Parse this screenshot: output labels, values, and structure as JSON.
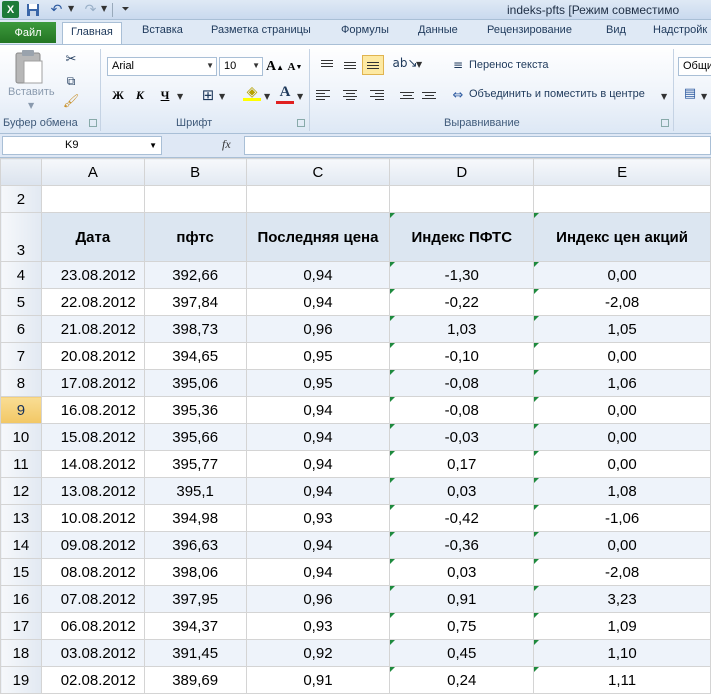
{
  "title_bar": {
    "window_title": "indeks-pfts  [Режим совместимо"
  },
  "ribbon_tabs": {
    "file": "Файл",
    "tabs": [
      "Главная",
      "Вставка",
      "Разметка страницы",
      "Формулы",
      "Данные",
      "Рецензирование",
      "Вид",
      "Надстройк"
    ]
  },
  "ribbon": {
    "paste_label": "Вставить",
    "groups": {
      "clipboard": "Буфер обмена",
      "font": "Шрифт",
      "alignment": "Выравнивание"
    },
    "font_name": "Arial",
    "font_size": "10",
    "bold": "Ж",
    "italic": "К",
    "underline": "Ч",
    "wrap_text": "Перенос текста",
    "merge_center": "Объединить и поместить в центре",
    "number_format": "Общи"
  },
  "formula_bar": {
    "name_box": "K9",
    "fx": "fx",
    "formula": ""
  },
  "sheet": {
    "columns": [
      "A",
      "B",
      "C",
      "D",
      "E"
    ],
    "selected_row": "9",
    "header_row_number": "3",
    "headers": [
      "Дата",
      "пфтс",
      "Последняя цена",
      "Индекс ПФТС",
      "Индекс цен акций"
    ],
    "rows": [
      {
        "n": "4",
        "date": "23.08.2012",
        "pfts": "392,66",
        "last": "0,94",
        "idx": "-1,30",
        "shares": "0,00"
      },
      {
        "n": "5",
        "date": "22.08.2012",
        "pfts": "397,84",
        "last": "0,94",
        "idx": "-0,22",
        "shares": "-2,08"
      },
      {
        "n": "6",
        "date": "21.08.2012",
        "pfts": "398,73",
        "last": "0,96",
        "idx": "1,03",
        "shares": "1,05"
      },
      {
        "n": "7",
        "date": "20.08.2012",
        "pfts": "394,65",
        "last": "0,95",
        "idx": "-0,10",
        "shares": "0,00"
      },
      {
        "n": "8",
        "date": "17.08.2012",
        "pfts": "395,06",
        "last": "0,95",
        "idx": "-0,08",
        "shares": "1,06"
      },
      {
        "n": "9",
        "date": "16.08.2012",
        "pfts": "395,36",
        "last": "0,94",
        "idx": "-0,08",
        "shares": "0,00"
      },
      {
        "n": "10",
        "date": "15.08.2012",
        "pfts": "395,66",
        "last": "0,94",
        "idx": "-0,03",
        "shares": "0,00"
      },
      {
        "n": "11",
        "date": "14.08.2012",
        "pfts": "395,77",
        "last": "0,94",
        "idx": "0,17",
        "shares": "0,00"
      },
      {
        "n": "12",
        "date": "13.08.2012",
        "pfts": "395,1",
        "last": "0,94",
        "idx": "0,03",
        "shares": "1,08"
      },
      {
        "n": "13",
        "date": "10.08.2012",
        "pfts": "394,98",
        "last": "0,93",
        "idx": "-0,42",
        "shares": "-1,06"
      },
      {
        "n": "14",
        "date": "09.08.2012",
        "pfts": "396,63",
        "last": "0,94",
        "idx": "-0,36",
        "shares": "0,00"
      },
      {
        "n": "15",
        "date": "08.08.2012",
        "pfts": "398,06",
        "last": "0,94",
        "idx": "0,03",
        "shares": "-2,08"
      },
      {
        "n": "16",
        "date": "07.08.2012",
        "pfts": "397,95",
        "last": "0,96",
        "idx": "0,91",
        "shares": "3,23"
      },
      {
        "n": "17",
        "date": "06.08.2012",
        "pfts": "394,37",
        "last": "0,93",
        "idx": "0,75",
        "shares": "1,09"
      },
      {
        "n": "18",
        "date": "03.08.2012",
        "pfts": "391,45",
        "last": "0,92",
        "idx": "0,45",
        "shares": "1,10"
      },
      {
        "n": "19",
        "date": "02.08.2012",
        "pfts": "389,69",
        "last": "0,91",
        "idx": "0,24",
        "shares": "1,11"
      }
    ]
  }
}
